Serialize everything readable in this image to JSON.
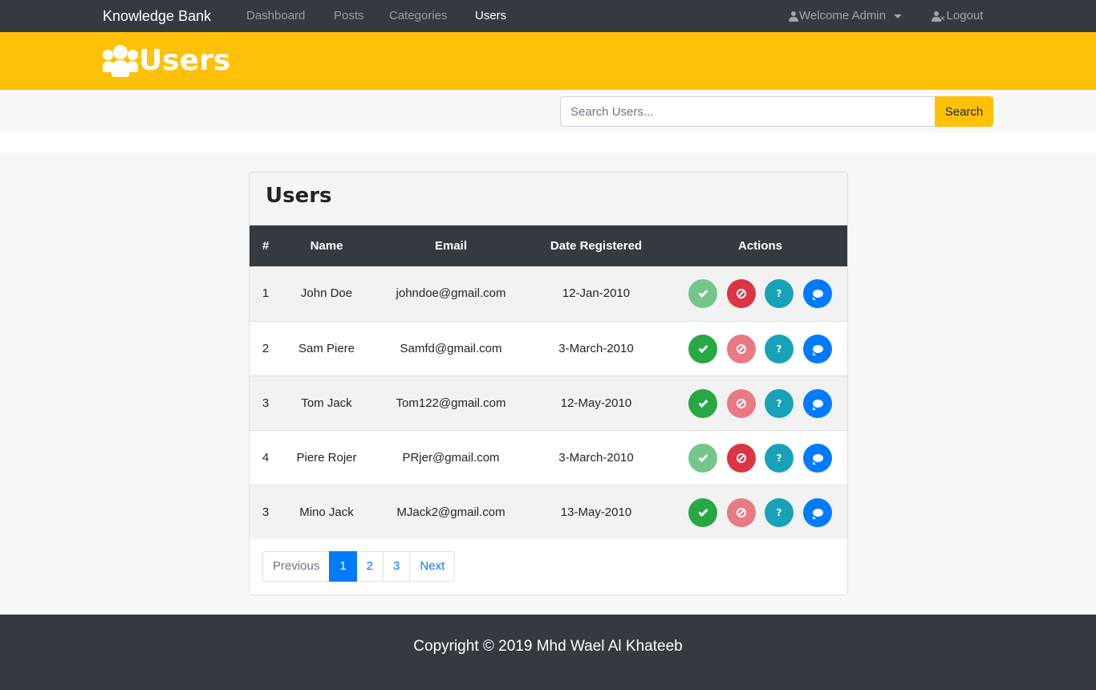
{
  "navbar": {
    "brand": "Knowledge Bank",
    "links": [
      "Dashboard",
      "Posts",
      "Categories",
      "Users"
    ],
    "active_link": "Users",
    "welcome": "Welcome Admin",
    "logout": "Logout"
  },
  "header": {
    "title": "Users",
    "icon": "users-icon"
  },
  "search": {
    "placeholder": "Search Users...",
    "button": "Search"
  },
  "card": {
    "title": "Users",
    "columns": [
      "#",
      "Name",
      "Email",
      "Date Registered",
      "Actions"
    ],
    "rows": [
      {
        "num": "1",
        "name": "John Doe",
        "email": "johndoe@gmail.com",
        "date": "12-Jan-2010",
        "approve_enabled": false,
        "block_enabled": true
      },
      {
        "num": "2",
        "name": "Sam Piere",
        "email": "Samfd@gmail.com",
        "date": "3-March-2010",
        "approve_enabled": true,
        "block_enabled": false
      },
      {
        "num": "3",
        "name": "Tom Jack",
        "email": "Tom122@gmail.com",
        "date": "12-May-2010",
        "approve_enabled": true,
        "block_enabled": false
      },
      {
        "num": "4",
        "name": "Piere Rojer",
        "email": "PRjer@gmail.com",
        "date": "3-March-2010",
        "approve_enabled": false,
        "block_enabled": true
      },
      {
        "num": "3",
        "name": "Mino Jack",
        "email": "MJack2@gmail.com",
        "date": "13-May-2010",
        "approve_enabled": true,
        "block_enabled": false
      }
    ],
    "action_icons": [
      "check-icon",
      "ban-icon",
      "question-icon",
      "comment-icon"
    ]
  },
  "pagination": {
    "previous": "Previous",
    "pages": [
      "1",
      "2",
      "3"
    ],
    "current": "1",
    "next": "Next"
  },
  "footer": {
    "copyright": "Copyright © 2019 Mhd Wael Al Khateeb"
  },
  "colors": {
    "navbar": "#343a40",
    "header": "#ffc107",
    "approve": "#28a745",
    "block": "#dc3545",
    "info": "#17a2b8",
    "message": "#007bff"
  }
}
